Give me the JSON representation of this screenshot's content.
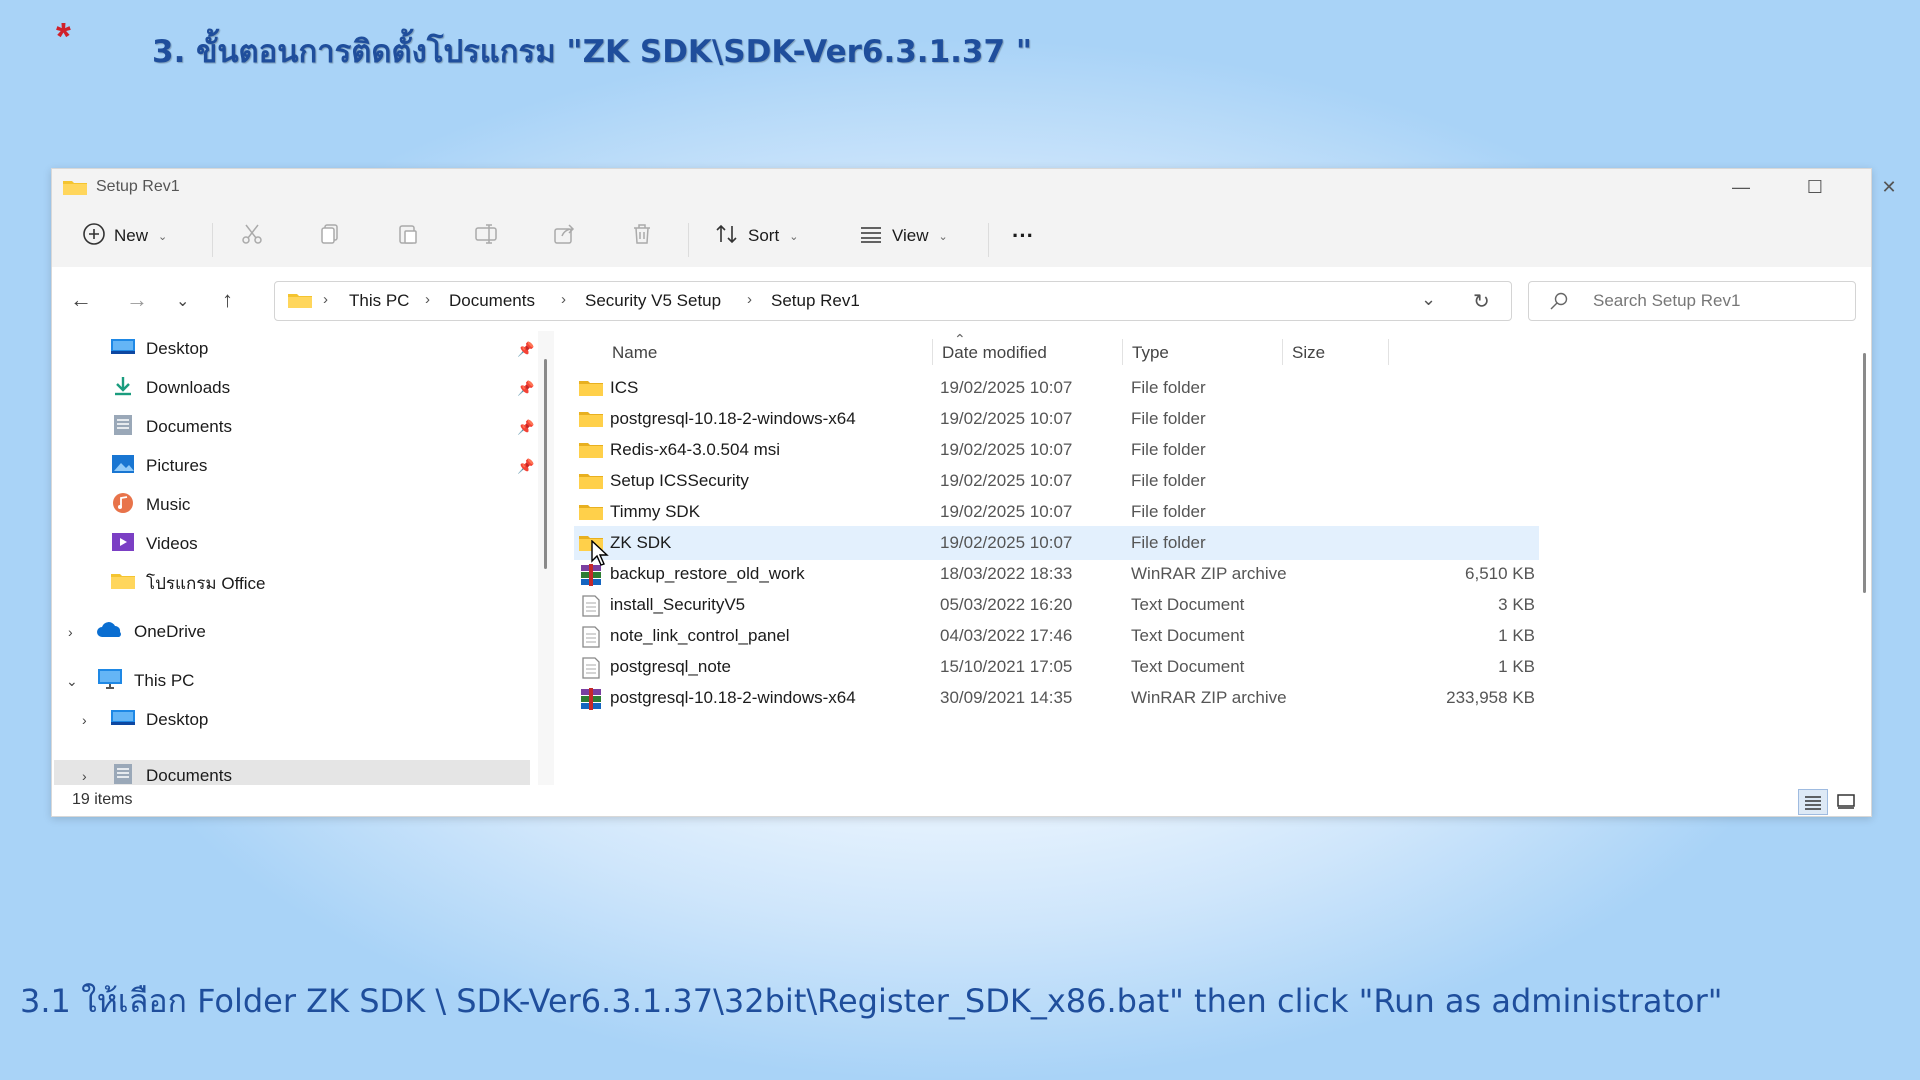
{
  "slide": {
    "marker": "*",
    "title": "3. ขั้นตอนการติดตั้งโปรแกรม \"ZK SDK\\SDK-Ver6.3.1.37 \"",
    "caption": "3.1 ให้เลือก Folder ZK SDK \\ SDK-Ver6.3.1.37\\32bit\\Register_SDK_x86.bat\" then click \"Run as administrator\""
  },
  "window": {
    "title": "Setup Rev1",
    "controls": {
      "minimize": "—",
      "maximize": "☐",
      "close": "✕"
    }
  },
  "toolbar": {
    "new_label": "New",
    "sort_label": "Sort",
    "view_label": "View",
    "more_label": "···"
  },
  "address": {
    "crumbs": [
      "This PC",
      "Documents",
      "Security V5 Setup",
      "Setup Rev1"
    ],
    "search_placeholder": "Search Setup Rev1"
  },
  "nav": {
    "quick": [
      {
        "label": "Desktop",
        "icon": "desktop-icon"
      },
      {
        "label": "Downloads",
        "icon": "download-icon"
      },
      {
        "label": "Documents",
        "icon": "documents-icon"
      },
      {
        "label": "Pictures",
        "icon": "pictures-icon"
      },
      {
        "label": "Music",
        "icon": "music-icon"
      },
      {
        "label": "Videos",
        "icon": "videos-icon"
      },
      {
        "label": "โปรแกรม Office",
        "icon": "folder-icon"
      }
    ],
    "onedrive": "OneDrive",
    "thispc": "This PC",
    "thispc_children": [
      "Desktop",
      "Documents"
    ]
  },
  "columns": {
    "name": "Name",
    "date": "Date modified",
    "type": "Type",
    "size": "Size"
  },
  "files": [
    {
      "name": "ICS",
      "date": "19/02/2025 10:07",
      "type": "File folder",
      "size": "",
      "kind": "folder"
    },
    {
      "name": "postgresql-10.18-2-windows-x64",
      "date": "19/02/2025 10:07",
      "type": "File folder",
      "size": "",
      "kind": "folder"
    },
    {
      "name": "Redis-x64-3.0.504 msi",
      "date": "19/02/2025 10:07",
      "type": "File folder",
      "size": "",
      "kind": "folder"
    },
    {
      "name": "Setup ICSSecurity",
      "date": "19/02/2025 10:07",
      "type": "File folder",
      "size": "",
      "kind": "folder"
    },
    {
      "name": "Timmy SDK",
      "date": "19/02/2025 10:07",
      "type": "File folder",
      "size": "",
      "kind": "folder"
    },
    {
      "name": "ZK SDK",
      "date": "19/02/2025 10:07",
      "type": "File folder",
      "size": "",
      "kind": "folder"
    },
    {
      "name": "backup_restore_old_work",
      "date": "18/03/2022 18:33",
      "type": "WinRAR ZIP archive",
      "size": "6,510 KB",
      "kind": "zip"
    },
    {
      "name": "install_SecurityV5",
      "date": "05/03/2022 16:20",
      "type": "Text Document",
      "size": "3 KB",
      "kind": "text"
    },
    {
      "name": "note_link_control_panel",
      "date": "04/03/2022 17:46",
      "type": "Text Document",
      "size": "1 KB",
      "kind": "text"
    },
    {
      "name": "postgresql_note",
      "date": "15/10/2021 17:05",
      "type": "Text Document",
      "size": "1 KB",
      "kind": "text"
    },
    {
      "name": "postgresql-10.18-2-windows-x64",
      "date": "30/09/2021 14:35",
      "type": "WinRAR ZIP archive",
      "size": "233,958 KB",
      "kind": "zip"
    }
  ],
  "selected_file": "ZK SDK",
  "status": {
    "items": "19 items"
  },
  "colors": {
    "accent": "#1f4e9c",
    "marker": "#d0202a",
    "folder": "#f4c430",
    "selection": "#e3f0fd"
  }
}
